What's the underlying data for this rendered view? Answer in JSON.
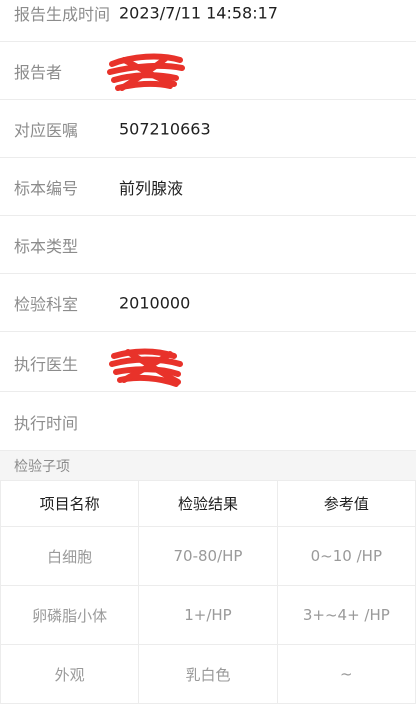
{
  "report_info": {
    "generated_time_label": "报告生成时间",
    "generated_time_value": "2023/7/11 14:58:17",
    "reporter_label": "报告者",
    "order_label": "对应医嘱",
    "order_value": "507210663",
    "specimen_no_label": "标本编号",
    "specimen_no_value": "前列腺液",
    "specimen_type_label": "标本类型",
    "specimen_type_value": "",
    "dept_label": "检验科室",
    "dept_value": "2010000",
    "executor_label": "执行医生",
    "exec_time_label": "执行时间",
    "exec_time_value": ""
  },
  "section_title": "检验子项",
  "table": {
    "headers": [
      "项目名称",
      "检验结果",
      "参考值"
    ],
    "rows": [
      [
        "白细胞",
        "70-80/HP",
        "0~10 /HP"
      ],
      [
        "卵磷脂小体",
        "1+/HP",
        "3+~4+ /HP"
      ],
      [
        "外观",
        "乳白色",
        "~"
      ]
    ]
  },
  "colors": {
    "redaction": "#e8322a",
    "label": "#8c8c8c",
    "value": "#1f1f1f",
    "section_bg": "#f5f5f5",
    "divider": "#ececec"
  }
}
